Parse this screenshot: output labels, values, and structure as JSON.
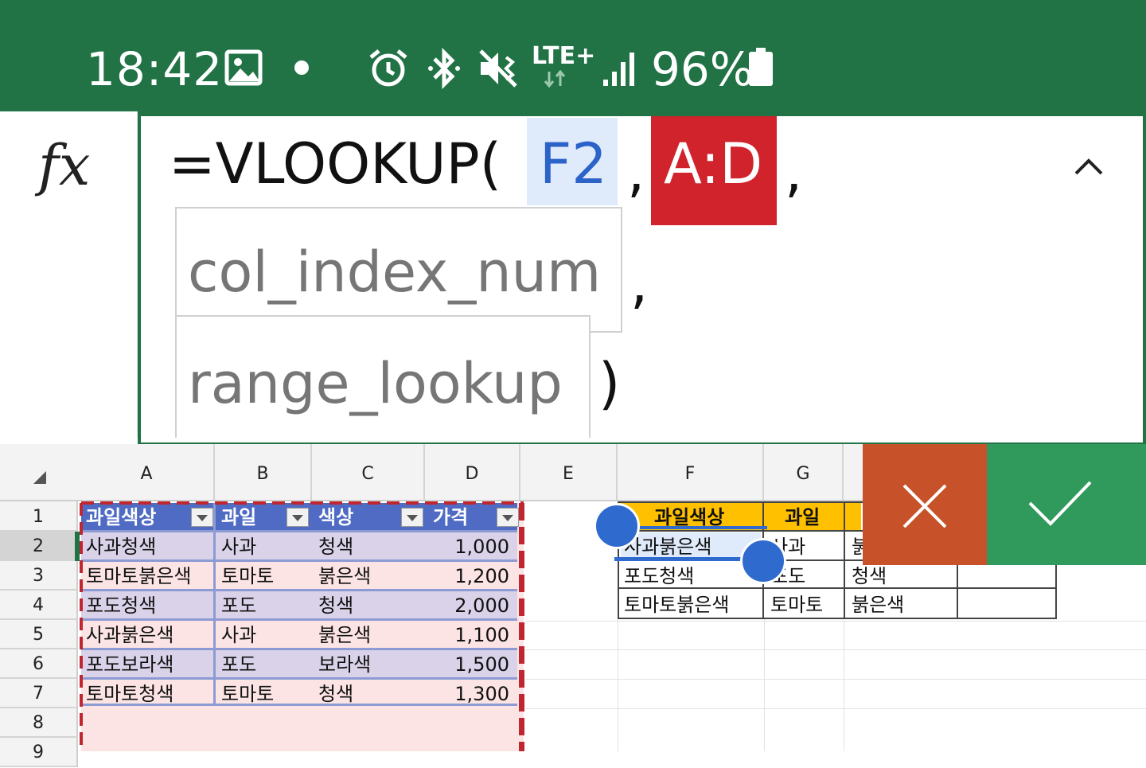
{
  "status_bar": {
    "time": "18:42",
    "icons": [
      "image-icon",
      "dot-icon",
      "alarm-icon",
      "bluetooth-icon",
      "vibrate-icon",
      "lte-icon",
      "signal-icon",
      "battery-icon"
    ],
    "network": "LTE+",
    "battery": "96%",
    "bg_color": "#217346"
  },
  "formula_bar": {
    "fx_label": "fx",
    "prefix": "=VLOOKUP(",
    "arg1": "F2",
    "sep1": ",",
    "arg2": "A:D",
    "sep2": ",",
    "arg3": "col_index_num",
    "sep3": ",",
    "arg4": "range_lookup",
    "close": ")",
    "collapse_label": "^"
  },
  "grid": {
    "columns": [
      "A",
      "B",
      "C",
      "D",
      "E",
      "F",
      "G"
    ],
    "rows": [
      "1",
      "2",
      "3",
      "4",
      "5",
      "6",
      "7",
      "8",
      "9"
    ],
    "selected_row": "2"
  },
  "table": {
    "headers": [
      "과일색상",
      "과일",
      "색상",
      "가격"
    ],
    "rows": [
      [
        "사과청색",
        "사과",
        "청색",
        "1,000"
      ],
      [
        "토마토붉은색",
        "토마토",
        "붉은색",
        "1,200"
      ],
      [
        "포도청색",
        "포도",
        "청색",
        "2,000"
      ],
      [
        "사과붉은색",
        "사과",
        "붉은색",
        "1,100"
      ],
      [
        "포도보라색",
        "포도",
        "보라색",
        "1,500"
      ],
      [
        "토마토청색",
        "토마토",
        "청색",
        "1,300"
      ]
    ]
  },
  "lookup_table": {
    "headers": [
      "과일색상",
      "과일"
    ],
    "rows": [
      [
        "사과붉은색",
        "사과",
        "붉"
      ],
      [
        "포도청색",
        "포도",
        "청색"
      ],
      [
        "토마토붉은색",
        "토마토",
        "붉은색"
      ]
    ]
  },
  "actions": {
    "cancel_symbol": "✕",
    "confirm_symbol": "✓",
    "cancel_color": "#c7522a",
    "confirm_color": "#2f9a5b"
  }
}
